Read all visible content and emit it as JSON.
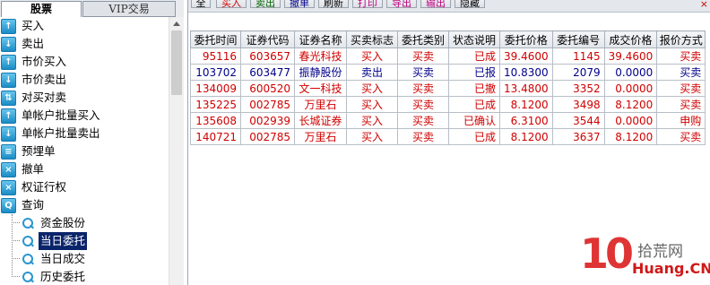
{
  "tabs": {
    "stock": "股票",
    "vip": "VIP交易"
  },
  "tree": {
    "items": [
      {
        "label": "买入",
        "icon": "buy-icon"
      },
      {
        "label": "卖出",
        "icon": "sell-icon"
      },
      {
        "label": "市价买入",
        "icon": "market-buy-icon"
      },
      {
        "label": "市价卖出",
        "icon": "market-sell-icon"
      },
      {
        "label": "对买对卖",
        "icon": "swap-icon"
      },
      {
        "label": "单帐户批量买入",
        "icon": "batch-buy-icon"
      },
      {
        "label": "单帐户批量卖出",
        "icon": "batch-sell-icon"
      },
      {
        "label": "预埋单",
        "icon": "preorder-icon"
      },
      {
        "label": "撤单",
        "icon": "cancel-icon"
      },
      {
        "label": "权证行权",
        "icon": "warrant-icon"
      },
      {
        "label": "查询",
        "icon": "query-icon"
      }
    ],
    "subitems": [
      {
        "label": "资金股份"
      },
      {
        "label": "当日委托"
      },
      {
        "label": "当日成交"
      },
      {
        "label": "历史委托"
      }
    ],
    "selected": "当日委托"
  },
  "toolbar": {
    "buttons": [
      "全选",
      "买入",
      "卖出",
      "撤单",
      "刷新",
      "打印",
      "导出",
      "输出",
      "隐藏"
    ],
    "close": "×"
  },
  "grid": {
    "columns": [
      "委托时间",
      "证券代码",
      "证券名称",
      "买卖标志",
      "委托类别",
      "状态说明",
      "委托价格",
      "委托编号",
      "成交价格",
      "报价方式"
    ],
    "rows": [
      {
        "side": "buy",
        "cells": [
          "95116",
          "603657",
          "春光科技",
          "买入",
          "买卖",
          "已成",
          "39.4600",
          "1145",
          "39.4600",
          "买卖"
        ]
      },
      {
        "side": "sell",
        "cells": [
          "103702",
          "603477",
          "振静股份",
          "卖出",
          "买卖",
          "已报",
          "10.8300",
          "2079",
          "0.0000",
          "买卖"
        ]
      },
      {
        "side": "buy",
        "cells": [
          "134009",
          "600520",
          "文一科技",
          "买入",
          "买卖",
          "已撤",
          "13.4800",
          "3352",
          "0.0000",
          "买卖"
        ]
      },
      {
        "side": "buy",
        "cells": [
          "135225",
          "002785",
          "万里石",
          "买入",
          "买卖",
          "已成",
          "8.1200",
          "3498",
          "8.1200",
          "买卖"
        ]
      },
      {
        "side": "buy",
        "cells": [
          "135608",
          "002939",
          "长城证券",
          "买入",
          "买卖",
          "已确认",
          "6.3100",
          "3544",
          "0.0000",
          "申购"
        ]
      },
      {
        "side": "buy",
        "cells": [
          "140721",
          "002785",
          "万里石",
          "买入",
          "买卖",
          "已成",
          "8.1200",
          "3637",
          "8.1200",
          "买卖"
        ]
      }
    ]
  },
  "watermark": {
    "big": "10",
    "cn": "拾荒网",
    "en": "Huang.CN"
  },
  "colors": {
    "buy": "#d00000",
    "sell": "#00008b",
    "selection": "#0a246a"
  }
}
